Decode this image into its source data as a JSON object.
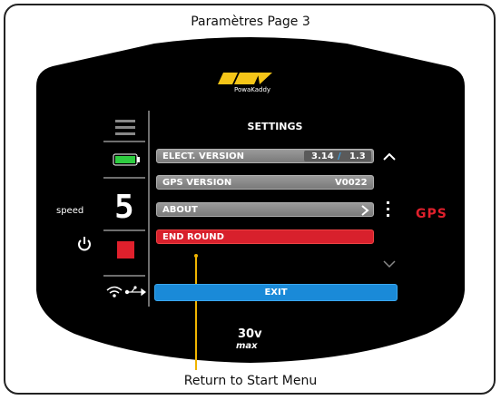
{
  "page_title": "Paramètres Page 3",
  "footer_caption": "Return to Start Menu",
  "brand": {
    "logo_text": "PowaKaddy",
    "model_top": "30v",
    "model_bottom": "max"
  },
  "left_panel": {
    "menu_icon": "hamburger-menu-icon",
    "battery_icon": "battery-full-icon",
    "speed_value": "5",
    "speed_label": "speed",
    "power_icon": "power-icon",
    "stop_icon": "stop-square-icon",
    "status_icons": [
      "wifi-icon",
      "usb-icon"
    ]
  },
  "settings": {
    "title": "SETTINGS",
    "items": [
      {
        "label": "ELECT. VERSION",
        "value_a": "3.14",
        "separator": "/",
        "value_b": "1.3"
      },
      {
        "label": "GPS VERSION",
        "value": "V0022"
      },
      {
        "label": "ABOUT",
        "chevron": "chevron-right-icon"
      },
      {
        "label": "END ROUND"
      }
    ],
    "exit_label": "EXIT",
    "scroll_up_icon": "chevron-up-icon",
    "scroll_down_icon": "chevron-down-icon",
    "more_icon": "vertical-dots-icon"
  },
  "right_panel": {
    "gps_label": "GPS"
  },
  "colors": {
    "device": "#000000",
    "accent_red": "#d8202c",
    "exit_blue": "#1a8ad8",
    "battery_green": "#2ecc40",
    "logo_yellow": "#f5c518",
    "callout_line": "#f0b400"
  }
}
